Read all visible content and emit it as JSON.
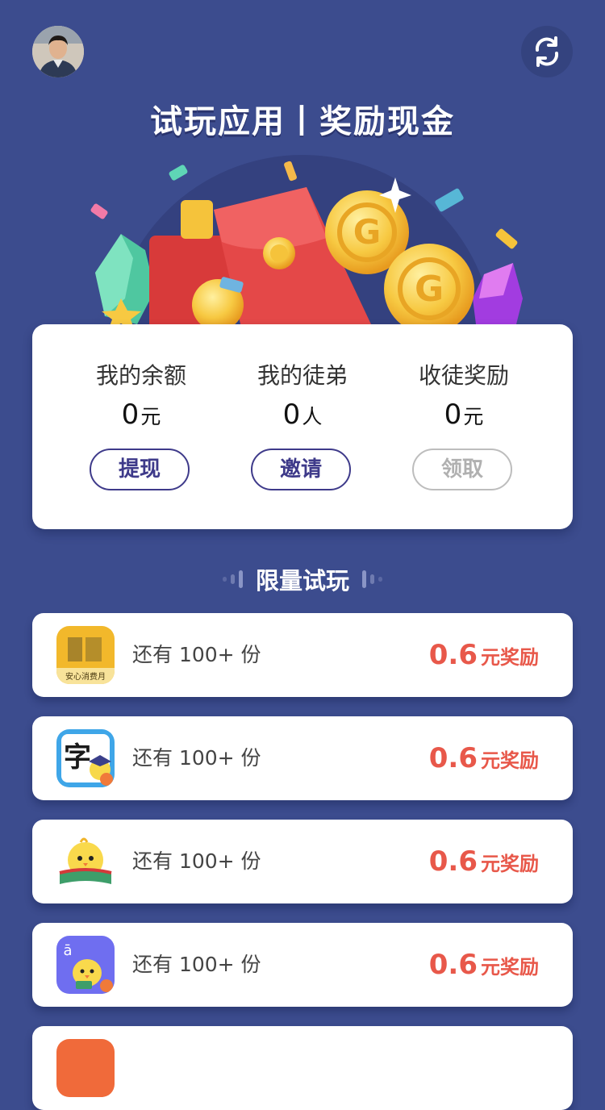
{
  "header": {
    "title": "试玩应用丨奖励现金",
    "avatar_icon": "user-avatar",
    "refresh_icon": "refresh-icon"
  },
  "stats": [
    {
      "label": "我的余额",
      "value": "0",
      "unit": "元",
      "button": "提现",
      "button_enabled": true
    },
    {
      "label": "我的徒弟",
      "value": "0",
      "unit": "人",
      "button": "邀请",
      "button_enabled": true
    },
    {
      "label": "收徒奖励",
      "value": "0",
      "unit": "元",
      "button": "领取",
      "button_enabled": false
    }
  ],
  "section": {
    "title": "限量试玩"
  },
  "tasks": [
    {
      "icon": "app-icon-yellow-shopping",
      "remaining": "还有 100+ 份",
      "reward_amount": "0.6",
      "reward_unit": "元奖励",
      "icon_caption": "安心消费月"
    },
    {
      "icon": "app-icon-zi-character",
      "remaining": "还有 100+ 份",
      "reward_amount": "0.6",
      "reward_unit": "元奖励",
      "icon_glyph": "字"
    },
    {
      "icon": "app-icon-chick-book",
      "remaining": "还有 100+ 份",
      "reward_amount": "0.6",
      "reward_unit": "元奖励"
    },
    {
      "icon": "app-icon-chick-pinyin",
      "remaining": "还有 100+ 份",
      "reward_amount": "0.6",
      "reward_unit": "元奖励",
      "icon_glyph": "ā"
    }
  ],
  "colors": {
    "background": "#3c4c8e",
    "accent": "#3e3a8a",
    "reward": "#e8584a",
    "disabled": "#b0b0b0"
  }
}
